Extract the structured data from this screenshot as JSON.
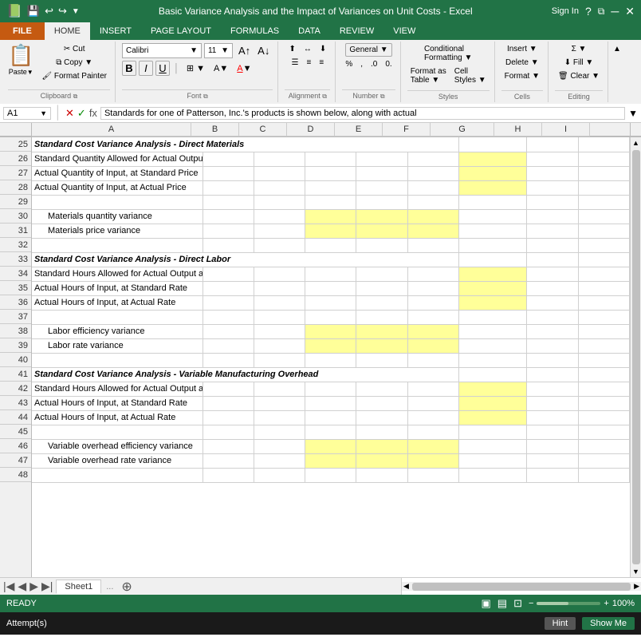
{
  "titleBar": {
    "title": "Basic Variance Analysis and the Impact of Variances on Unit Costs - Excel",
    "leftIcons": [
      "save-icon",
      "undo-icon",
      "redo-icon",
      "customize-icon"
    ],
    "rightIcons": [
      "help-icon",
      "restore-icon",
      "minimize-icon",
      "close-icon"
    ],
    "signinLabel": "Sign In"
  },
  "ribbonTabs": [
    "FILE",
    "HOME",
    "INSERT",
    "PAGE LAYOUT",
    "FORMULAS",
    "DATA",
    "REVIEW",
    "VIEW"
  ],
  "activeTab": "HOME",
  "ribbon": {
    "groups": [
      {
        "name": "Clipboard",
        "items": [
          "Paste",
          "Cut",
          "Copy",
          "Format Painter"
        ]
      },
      {
        "name": "Font",
        "fontName": "Calibri",
        "fontSize": "11",
        "boldLabel": "B",
        "italicLabel": "I",
        "underlineLabel": "U"
      },
      {
        "name": "Alignment",
        "label": "Alignment"
      },
      {
        "name": "Number",
        "label": "Number"
      },
      {
        "name": "Styles",
        "items": [
          "Conditional Formatting",
          "Format as Table",
          "Cell Styles"
        ],
        "label": "Styles"
      },
      {
        "name": "Cells",
        "label": "Cells"
      },
      {
        "name": "Editing",
        "label": "Editing"
      }
    ]
  },
  "formulaBar": {
    "cellRef": "A1",
    "formula": "Standards for one of Patterson, Inc.'s products is shown below, along with actual"
  },
  "columns": [
    "A",
    "B",
    "C",
    "D",
    "E",
    "F",
    "G",
    "H",
    "I"
  ],
  "rows": [
    {
      "rowNum": 25,
      "cells": [
        {
          "text": "Standard Cost Variance Analysis - Direct Materials",
          "style": "bold-italic",
          "colspan": 9
        },
        {
          "text": ""
        },
        {
          "text": ""
        },
        {
          "text": ""
        },
        {
          "text": ""
        },
        {
          "text": ""
        },
        {
          "text": ""
        },
        {
          "text": ""
        },
        {
          "text": ""
        }
      ]
    },
    {
      "rowNum": 26,
      "cells": [
        {
          "text": "Standard Quantity Allowed for Actual Output at Standard Price"
        },
        {
          "text": ""
        },
        {
          "text": ""
        },
        {
          "text": ""
        },
        {
          "text": ""
        },
        {
          "text": ""
        },
        {
          "text": "yellow"
        },
        {
          "text": ""
        },
        {
          "text": ""
        }
      ]
    },
    {
      "rowNum": 27,
      "cells": [
        {
          "text": "Actual Quantity of Input, at Standard Price"
        },
        {
          "text": ""
        },
        {
          "text": ""
        },
        {
          "text": ""
        },
        {
          "text": ""
        },
        {
          "text": ""
        },
        {
          "text": "yellow"
        },
        {
          "text": ""
        },
        {
          "text": ""
        }
      ]
    },
    {
      "rowNum": 28,
      "cells": [
        {
          "text": "Actual Quantity of Input, at Actual Price"
        },
        {
          "text": ""
        },
        {
          "text": ""
        },
        {
          "text": ""
        },
        {
          "text": ""
        },
        {
          "text": ""
        },
        {
          "text": "yellow"
        },
        {
          "text": ""
        },
        {
          "text": ""
        }
      ]
    },
    {
      "rowNum": 29,
      "cells": [
        {
          "text": ""
        },
        {
          "text": ""
        },
        {
          "text": ""
        },
        {
          "text": ""
        },
        {
          "text": ""
        },
        {
          "text": ""
        },
        {
          "text": ""
        },
        {
          "text": ""
        },
        {
          "text": ""
        }
      ]
    },
    {
      "rowNum": 30,
      "cells": [
        {
          "text": "   Materials quantity variance",
          "indent": true
        },
        {
          "text": ""
        },
        {
          "text": ""
        },
        {
          "text": "yellow"
        },
        {
          "text": "yellow"
        },
        {
          "text": "yellow"
        },
        {
          "text": ""
        },
        {
          "text": ""
        },
        {
          "text": ""
        }
      ]
    },
    {
      "rowNum": 31,
      "cells": [
        {
          "text": "   Materials price variance",
          "indent": true
        },
        {
          "text": ""
        },
        {
          "text": ""
        },
        {
          "text": "yellow"
        },
        {
          "text": "yellow"
        },
        {
          "text": "yellow"
        },
        {
          "text": ""
        },
        {
          "text": ""
        },
        {
          "text": ""
        }
      ]
    },
    {
      "rowNum": 32,
      "cells": [
        {
          "text": ""
        },
        {
          "text": ""
        },
        {
          "text": ""
        },
        {
          "text": ""
        },
        {
          "text": ""
        },
        {
          "text": ""
        },
        {
          "text": ""
        },
        {
          "text": ""
        },
        {
          "text": ""
        }
      ]
    },
    {
      "rowNum": 33,
      "cells": [
        {
          "text": "Standard Cost Variance Analysis - Direct Labor",
          "style": "bold-italic"
        },
        {
          "text": ""
        },
        {
          "text": ""
        },
        {
          "text": ""
        },
        {
          "text": ""
        },
        {
          "text": ""
        },
        {
          "text": ""
        },
        {
          "text": ""
        },
        {
          "text": ""
        }
      ]
    },
    {
      "rowNum": 34,
      "cells": [
        {
          "text": "Standard Hours Allowed for Actual Output at Standard Rate"
        },
        {
          "text": ""
        },
        {
          "text": ""
        },
        {
          "text": ""
        },
        {
          "text": ""
        },
        {
          "text": ""
        },
        {
          "text": "yellow"
        },
        {
          "text": ""
        },
        {
          "text": ""
        }
      ]
    },
    {
      "rowNum": 35,
      "cells": [
        {
          "text": "Actual Hours of Input, at Standard Rate"
        },
        {
          "text": ""
        },
        {
          "text": ""
        },
        {
          "text": ""
        },
        {
          "text": ""
        },
        {
          "text": ""
        },
        {
          "text": "yellow"
        },
        {
          "text": ""
        },
        {
          "text": ""
        }
      ]
    },
    {
      "rowNum": 36,
      "cells": [
        {
          "text": "Actual Hours of Input, at Actual Rate"
        },
        {
          "text": ""
        },
        {
          "text": ""
        },
        {
          "text": ""
        },
        {
          "text": ""
        },
        {
          "text": ""
        },
        {
          "text": "yellow"
        },
        {
          "text": ""
        },
        {
          "text": ""
        }
      ]
    },
    {
      "rowNum": 37,
      "cells": [
        {
          "text": ""
        },
        {
          "text": ""
        },
        {
          "text": ""
        },
        {
          "text": ""
        },
        {
          "text": ""
        },
        {
          "text": ""
        },
        {
          "text": ""
        },
        {
          "text": ""
        },
        {
          "text": ""
        }
      ]
    },
    {
      "rowNum": 38,
      "cells": [
        {
          "text": "   Labor efficiency variance",
          "indent": true
        },
        {
          "text": ""
        },
        {
          "text": ""
        },
        {
          "text": "yellow"
        },
        {
          "text": "yellow"
        },
        {
          "text": "yellow"
        },
        {
          "text": ""
        },
        {
          "text": ""
        },
        {
          "text": ""
        }
      ]
    },
    {
      "rowNum": 39,
      "cells": [
        {
          "text": "   Labor rate variance",
          "indent": true
        },
        {
          "text": ""
        },
        {
          "text": ""
        },
        {
          "text": "yellow"
        },
        {
          "text": "yellow"
        },
        {
          "text": "yellow"
        },
        {
          "text": ""
        },
        {
          "text": ""
        },
        {
          "text": ""
        }
      ]
    },
    {
      "rowNum": 40,
      "cells": [
        {
          "text": ""
        },
        {
          "text": ""
        },
        {
          "text": ""
        },
        {
          "text": ""
        },
        {
          "text": ""
        },
        {
          "text": ""
        },
        {
          "text": ""
        },
        {
          "text": ""
        },
        {
          "text": ""
        }
      ]
    },
    {
      "rowNum": 41,
      "cells": [
        {
          "text": "Standard Cost Variance Analysis - Variable Manufacturing Overhead",
          "style": "bold-italic"
        },
        {
          "text": ""
        },
        {
          "text": ""
        },
        {
          "text": ""
        },
        {
          "text": ""
        },
        {
          "text": ""
        },
        {
          "text": ""
        },
        {
          "text": ""
        },
        {
          "text": ""
        }
      ]
    },
    {
      "rowNum": 42,
      "cells": [
        {
          "text": "Standard Hours Allowed for Actual Output at Standard Rate"
        },
        {
          "text": ""
        },
        {
          "text": ""
        },
        {
          "text": ""
        },
        {
          "text": ""
        },
        {
          "text": ""
        },
        {
          "text": "yellow"
        },
        {
          "text": ""
        },
        {
          "text": ""
        }
      ]
    },
    {
      "rowNum": 43,
      "cells": [
        {
          "text": "Actual Hours of Input, at Standard Rate"
        },
        {
          "text": ""
        },
        {
          "text": ""
        },
        {
          "text": ""
        },
        {
          "text": ""
        },
        {
          "text": ""
        },
        {
          "text": "yellow"
        },
        {
          "text": ""
        },
        {
          "text": ""
        }
      ]
    },
    {
      "rowNum": 44,
      "cells": [
        {
          "text": "Actual Hours of Input, at Actual Rate"
        },
        {
          "text": ""
        },
        {
          "text": ""
        },
        {
          "text": ""
        },
        {
          "text": ""
        },
        {
          "text": ""
        },
        {
          "text": "yellow"
        },
        {
          "text": ""
        },
        {
          "text": ""
        }
      ]
    },
    {
      "rowNum": 45,
      "cells": [
        {
          "text": ""
        },
        {
          "text": ""
        },
        {
          "text": ""
        },
        {
          "text": ""
        },
        {
          "text": ""
        },
        {
          "text": ""
        },
        {
          "text": ""
        },
        {
          "text": ""
        },
        {
          "text": ""
        }
      ]
    },
    {
      "rowNum": 46,
      "cells": [
        {
          "text": "   Variable overhead efficiency variance",
          "indent": true
        },
        {
          "text": ""
        },
        {
          "text": ""
        },
        {
          "text": "yellow"
        },
        {
          "text": "yellow"
        },
        {
          "text": "yellow"
        },
        {
          "text": ""
        },
        {
          "text": ""
        },
        {
          "text": ""
        }
      ]
    },
    {
      "rowNum": 47,
      "cells": [
        {
          "text": "   Variable overhead rate variance",
          "indent": true
        },
        {
          "text": ""
        },
        {
          "text": ""
        },
        {
          "text": "yellow"
        },
        {
          "text": "yellow"
        },
        {
          "text": "yellow"
        },
        {
          "text": ""
        },
        {
          "text": ""
        },
        {
          "text": ""
        }
      ]
    },
    {
      "rowNum": 48,
      "cells": [
        {
          "text": ""
        },
        {
          "text": ""
        },
        {
          "text": ""
        },
        {
          "text": ""
        },
        {
          "text": ""
        },
        {
          "text": ""
        },
        {
          "text": ""
        },
        {
          "text": ""
        },
        {
          "text": ""
        }
      ]
    }
  ],
  "sheetTabs": [
    "Sheet1"
  ],
  "activeSheet": "Sheet1",
  "statusBar": {
    "status": "READY",
    "viewIcons": [
      "normal-view",
      "page-layout-view",
      "page-break-preview"
    ],
    "zoomLevel": "100%"
  },
  "attemptBar": {
    "label": "Attempt(s)",
    "hintBtn": "Hint",
    "showMeBtn": "Show Me"
  }
}
